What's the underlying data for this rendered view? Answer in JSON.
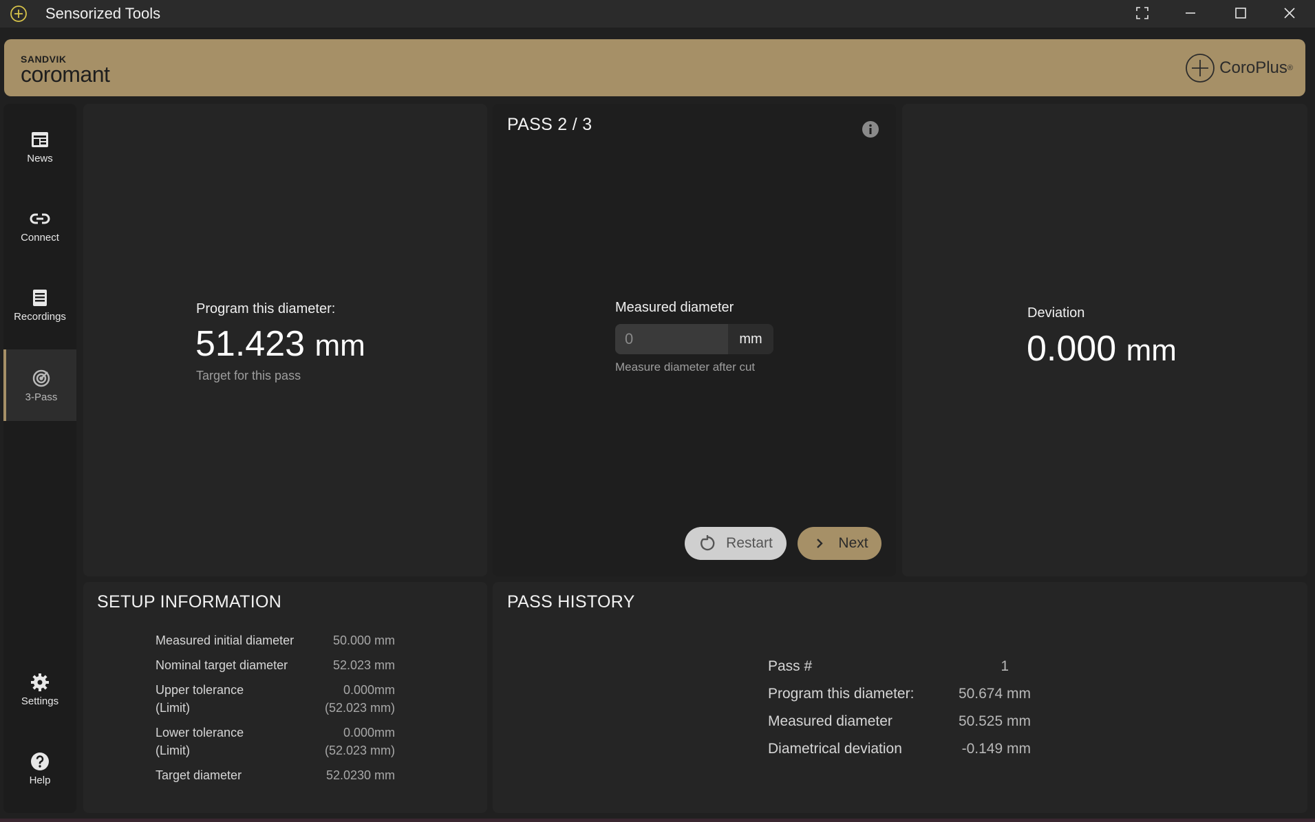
{
  "window": {
    "title": "Sensorized Tools"
  },
  "brand": {
    "sandvik": "SANDVIK",
    "coromant": "coromant",
    "coroplus": "CoroPlus",
    "registered": "®"
  },
  "sidebar": {
    "items": [
      {
        "label": "News"
      },
      {
        "label": "Connect"
      },
      {
        "label": "Recordings"
      },
      {
        "label": "3-Pass"
      },
      {
        "label": "Settings"
      },
      {
        "label": "Help"
      }
    ]
  },
  "program": {
    "label": "Program this diameter:",
    "value": "51.423",
    "unit": "mm",
    "hint": "Target for this pass"
  },
  "pass": {
    "title": "PASS 2 / 3",
    "measured_label": "Measured diameter",
    "input_value": "0",
    "input_unit": "mm",
    "input_hint": "Measure diameter after cut",
    "restart_label": "Restart",
    "next_label": "Next"
  },
  "deviation": {
    "label": "Deviation",
    "value": "0.000",
    "unit": "mm"
  },
  "setup": {
    "title": "SETUP INFORMATION",
    "rows": [
      {
        "key": "Measured initial diameter",
        "value": "50.000 mm"
      },
      {
        "key": "Nominal target diameter",
        "value": "52.023 mm"
      },
      {
        "key1": "Upper tolerance",
        "key2": "(Limit)",
        "value1": "0.000mm",
        "value2": "(52.023 mm)"
      },
      {
        "key1": "Lower tolerance",
        "key2": "(Limit)",
        "value1": "0.000mm",
        "value2": "(52.023 mm)"
      },
      {
        "key": "Target diameter",
        "value": "52.0230 mm"
      }
    ]
  },
  "history": {
    "title": "PASS HISTORY",
    "rows": [
      {
        "key": "Pass #",
        "value": "1"
      },
      {
        "key": "Program this diameter:",
        "value": "50.674 mm"
      },
      {
        "key": "Measured diameter",
        "value": "50.525 mm"
      },
      {
        "key": "Diametrical deviation",
        "value": "-0.149 mm"
      }
    ]
  },
  "colors": {
    "accent": "#a69067",
    "panel": "#252525",
    "background": "#202020"
  }
}
